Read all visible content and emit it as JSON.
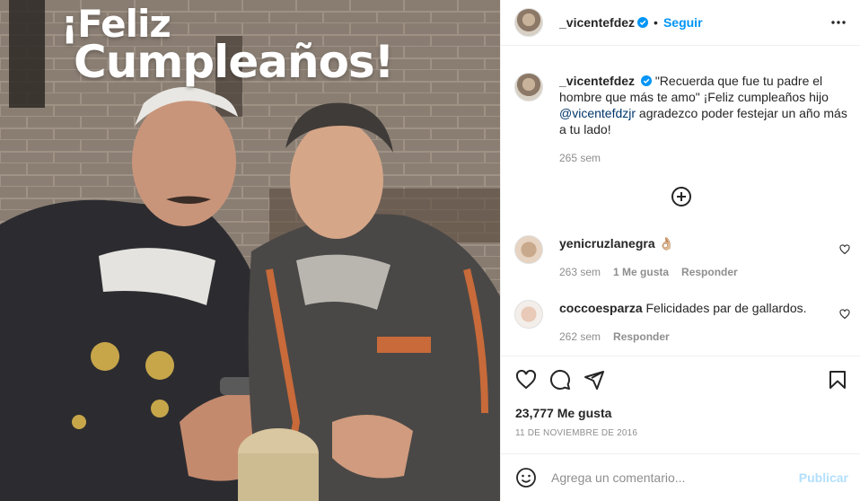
{
  "photo": {
    "caption_line1": "¡Feliz",
    "caption_line2": "Cumpleaños!"
  },
  "post_header": {
    "username": "_vicentefdez",
    "separator": "•",
    "follow_label": "Seguir",
    "verified_icon": "verified-badge-icon",
    "more_icon": "more-options-icon"
  },
  "caption": {
    "username": "_vicentefdez",
    "text_before": " \"Recuerda que fue tu padre el hombre que más te amo\" ¡Feliz cumpleaños hijo ",
    "mention": "@vicentefdzjr",
    "text_after": " agradezco poder festejar un año más a tu lado!",
    "time": "265 sem"
  },
  "load_more_icon": "plus-circle-icon",
  "comments": [
    {
      "username": "yenicruzlanegra",
      "text": "👌🏼",
      "time": "263 sem",
      "likes": "1 Me gusta",
      "reply": "Responder"
    },
    {
      "username": "coccoesparza",
      "text": "Felicidades par de gallardos.",
      "time": "262 sem",
      "reply": "Responder"
    }
  ],
  "actions": {
    "like_icon": "heart-icon",
    "comment_icon": "comment-icon",
    "share_icon": "share-icon",
    "save_icon": "bookmark-icon",
    "likes_count": "23,777 Me gusta",
    "date": "11 DE NOVIEMBRE DE 2016"
  },
  "add_comment": {
    "emoji_icon": "emoji-icon",
    "placeholder": "Agrega un comentario...",
    "publish_label": "Publicar"
  },
  "colors": {
    "accent": "#0095f6",
    "publish_disabled": "#b2dffc",
    "muted": "#8e8e8e",
    "mention": "#00376b"
  }
}
